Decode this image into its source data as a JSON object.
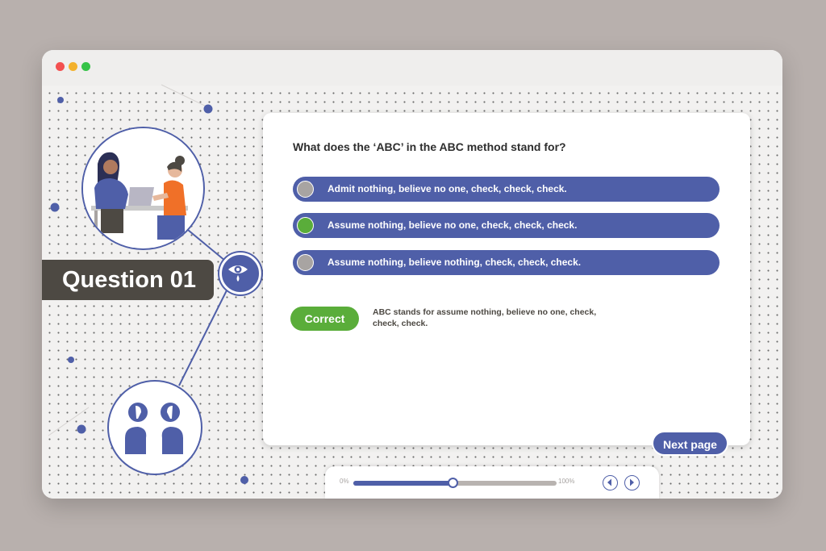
{
  "colors": {
    "primary": "#4f5fa8",
    "correct_green": "#5aad3a",
    "label_dark": "#4d4943",
    "radio_gray": "#a8a4a2"
  },
  "window_controls": [
    "close",
    "minimize",
    "maximize"
  ],
  "question_label": "Question 01",
  "question": {
    "text": "What does the ‘ABC’ in the ABC method stand for?",
    "options": [
      {
        "label": "Admit nothing, believe no one, check, check, check.",
        "selected": false
      },
      {
        "label": "Assume nothing, believe no one, check, check, check.",
        "selected": true
      },
      {
        "label": "Assume nothing, believe nothing, check, check, check.",
        "selected": false
      }
    ]
  },
  "feedback": {
    "status": "Correct",
    "explanation": "ABC stands for assume nothing, believe no one, check, check, check."
  },
  "next_button": "Next page",
  "progress": {
    "min_label": "0%",
    "max_label": "100%",
    "value": 0.49
  },
  "icons": [
    "eye-tear-icon",
    "prev-icon",
    "next-icon"
  ]
}
